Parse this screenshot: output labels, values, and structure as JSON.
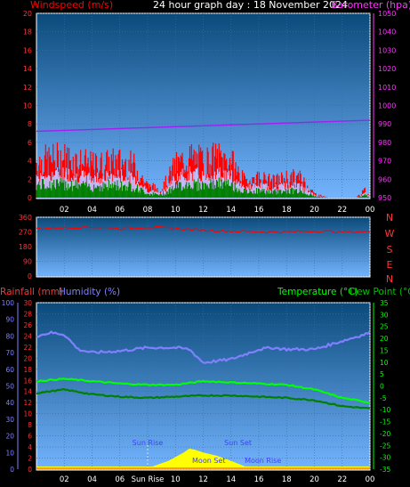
{
  "header": {
    "windspeed_label": "Windspeed (m/s)",
    "title": "24 hour graph day : 18 November 2024",
    "barometer_label": "Barometer (hpa)"
  },
  "lower_header": {
    "rainfall_label": "Rainfall (mm)",
    "humidity_label": "Humidity (%)",
    "temperature_label": "Temperature (°C)",
    "dewpoint_label": "Dew Point (°C)"
  },
  "compass": [
    "N",
    "W",
    "S",
    "E",
    "N"
  ],
  "x_ticks": [
    "02",
    "04",
    "06",
    "08",
    "10",
    "12",
    "14",
    "16",
    "18",
    "20",
    "22",
    "00"
  ],
  "x_ticks_bottom": [
    "02",
    "04",
    "06",
    "Sun Rise",
    "10",
    "12",
    "14",
    "16",
    "18",
    "20",
    "22",
    "00"
  ],
  "astro": {
    "sun_rise": "Sun Rise",
    "sun_set": "Sun Set",
    "moon_set": "Moon Set",
    "moon_rise": "Moon Rise"
  },
  "colors": {
    "wind": "#ff0000",
    "gust_light": "#c0c0ff",
    "wind_avg": "#008000",
    "barometer": "#a020f0",
    "direction": "#ff0000",
    "humidity": "#8080ff",
    "temperature": "#00ff00",
    "dewpoint": "#008000",
    "sun": "#ffff00",
    "panel_top": "#0a4a7a",
    "panel_bottom": "#70b0ff"
  },
  "chart_data": [
    {
      "type": "line",
      "title": "24 hour graph day : 18 November 2024",
      "x_range_hours": [
        0,
        24
      ],
      "left_axis": {
        "label": "Windspeed (m/s)",
        "ticks": [
          0,
          2,
          4,
          6,
          8,
          10,
          12,
          14,
          16,
          18,
          20
        ],
        "ylim": [
          0,
          20
        ]
      },
      "right_axis": {
        "label": "Barometer (hpa)",
        "ticks": [
          950,
          960,
          970,
          980,
          990,
          1000,
          1010,
          1020,
          1030,
          1040,
          1050
        ],
        "ylim": [
          950,
          1050
        ]
      },
      "series": [
        {
          "name": "Windspeed",
          "axis": "left",
          "x": [
            0,
            2,
            4,
            6,
            7,
            8,
            9,
            10,
            11,
            12,
            13,
            14,
            15,
            16,
            17,
            18,
            19,
            20,
            21,
            22,
            23,
            23.7,
            24
          ],
          "y": [
            4.5,
            5,
            4,
            4.5,
            4,
            1.5,
            1,
            4,
            5,
            4.5,
            5,
            4.5,
            2,
            2.5,
            2,
            2.5,
            2.5,
            0.5,
            0,
            0,
            0,
            1,
            0
          ]
        },
        {
          "name": "Barometer",
          "axis": "right",
          "x": [
            0,
            4,
            8,
            12,
            16,
            20,
            24
          ],
          "y": [
            986,
            987,
            988,
            989,
            990,
            991,
            992
          ]
        }
      ]
    },
    {
      "type": "line",
      "left_axis": {
        "ticks": [
          0,
          90,
          180,
          270,
          360
        ],
        "ylim": [
          0,
          360
        ]
      },
      "series": [
        {
          "name": "Wind Direction",
          "x": [
            0,
            2,
            4,
            6,
            8,
            10,
            12,
            14,
            16,
            18,
            20,
            22,
            24
          ],
          "y": [
            290,
            295,
            300,
            290,
            300,
            290,
            280,
            275,
            270,
            270,
            275,
            270,
            270
          ]
        }
      ]
    },
    {
      "type": "line",
      "axes": {
        "rainfall": {
          "label": "Rainfall (mm)",
          "ticks": [
            0,
            2,
            4,
            6,
            8,
            10,
            12,
            14,
            16,
            18,
            20,
            22,
            24,
            26,
            28,
            30
          ],
          "ylim": [
            0,
            30
          ]
        },
        "humidity": {
          "label": "Humidity (%)",
          "ticks": [
            0,
            10,
            20,
            30,
            40,
            50,
            60,
            70,
            80,
            90,
            100
          ],
          "ylim": [
            0,
            100
          ]
        },
        "temperature": {
          "label": "Temperature (°C)",
          "ticks": [
            35,
            30,
            25,
            20,
            15,
            10,
            5,
            0,
            -5,
            -10,
            -15,
            -20,
            -25,
            -30,
            -35
          ],
          "ylim": [
            -35,
            35
          ]
        }
      },
      "series": [
        {
          "name": "Humidity",
          "axis": "humidity",
          "x": [
            0,
            1,
            2,
            3,
            4,
            6,
            8,
            10,
            11,
            12,
            13,
            14,
            15,
            16,
            17,
            18,
            20,
            22,
            24
          ],
          "y": [
            80,
            82,
            81,
            72,
            70,
            71,
            73,
            73,
            72,
            64,
            65,
            66,
            69,
            72,
            73,
            72,
            72,
            77,
            82
          ]
        },
        {
          "name": "Temperature",
          "axis": "temperature",
          "x": [
            0,
            2,
            4,
            6,
            8,
            10,
            12,
            14,
            16,
            18,
            20,
            22,
            24
          ],
          "y": [
            2,
            3,
            2,
            1,
            0.5,
            0.5,
            2,
            1.5,
            1,
            0.5,
            -1.5,
            -5,
            -7
          ]
        },
        {
          "name": "Dew Point",
          "axis": "temperature",
          "x": [
            0,
            2,
            4,
            6,
            8,
            10,
            12,
            14,
            16,
            18,
            20,
            22,
            24
          ],
          "y": [
            -3,
            -1.5,
            -3.5,
            -4.5,
            -5,
            -4.5,
            -4,
            -4,
            -4.5,
            -5,
            -6,
            -8.5,
            -9.5
          ]
        },
        {
          "name": "Rainfall",
          "axis": "rainfall",
          "x": [
            0,
            24
          ],
          "y": [
            0,
            0
          ]
        }
      ]
    }
  ]
}
